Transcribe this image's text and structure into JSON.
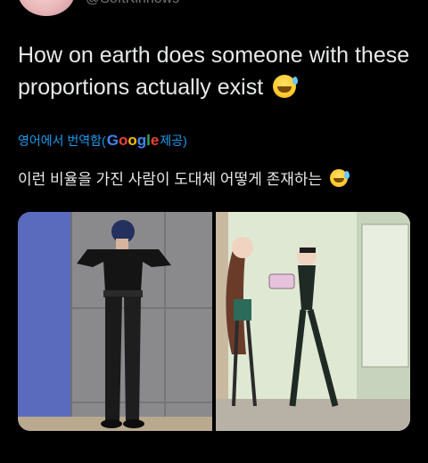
{
  "handle": "@SoftKinnows",
  "tweet": {
    "text": "How on earth does someone with these proportions actually exist",
    "emoji": "sweat-smile-emoji"
  },
  "translation": {
    "prefix": "영어에서 번역함(",
    "provider_letters": [
      "G",
      "o",
      "o",
      "g",
      "l",
      "e"
    ],
    "suffix": " 제공)",
    "text": "이런 비율을 가진 사람이 도대체 어떻게 존재하는"
  },
  "media": [
    {
      "name": "photo-person-posing"
    },
    {
      "name": "anime-screenshot"
    }
  ],
  "colors": {
    "background": "#000000",
    "text": "#e7e9ea",
    "link": "#1d9bf0",
    "muted": "#71767b"
  }
}
